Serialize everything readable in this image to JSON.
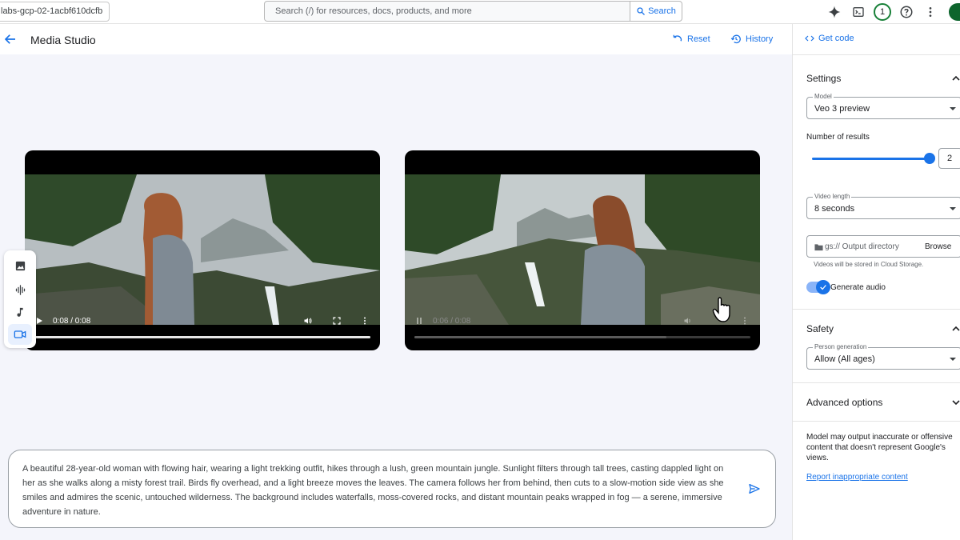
{
  "topbar": {
    "project": "labs-gcp-02-1acbf610dcfb",
    "search_placeholder": "Search (/) for resources, docs, products, and more",
    "search_button": "Search",
    "notification_count": "1"
  },
  "header": {
    "title": "Media Studio",
    "reset": "Reset",
    "history": "History"
  },
  "videos": [
    {
      "time": "0:08 / 0:08",
      "state": "paused",
      "progress": 1.0
    },
    {
      "time": "0:06 / 0:08",
      "state": "playing",
      "progress": 0.75
    }
  ],
  "media_toolbar": [
    "image-icon",
    "audio-wave-icon",
    "music-note-icon",
    "video-icon"
  ],
  "prompt": {
    "text": "A beautiful 28-year-old woman with flowing hair, wearing a light trekking outfit, hikes through a lush, green mountain jungle. Sunlight filters through tall trees, casting dappled light on her as she walks along a misty forest trail. Birds fly overhead, and a light breeze moves the leaves. The camera follows her from behind, then cuts to a slow-motion side view as she smiles and admires the scenic, untouched wilderness. The background includes waterfalls, moss-covered rocks, and distant mountain peaks wrapped in fog — a serene, immersive adventure in nature."
  },
  "panel": {
    "get_code": "Get code",
    "settings": {
      "title": "Settings",
      "model_label": "Model",
      "model_value": "Veo 3 preview",
      "results_label": "Number of results",
      "results_value": "2",
      "length_label": "Video length",
      "length_value": "8 seconds",
      "output_placeholder": "gs:// Output directory",
      "browse": "Browse",
      "storage_note": "Videos will be stored in Cloud Storage.",
      "generate_audio": "Generate audio",
      "generate_audio_on": true
    },
    "safety": {
      "title": "Safety",
      "person_label": "Person generation",
      "person_value": "Allow (All ages)"
    },
    "advanced": {
      "title": "Advanced options"
    },
    "disclaimer": "Model may output inaccurate or offensive content that doesn't represent Google's views.",
    "report": "Report inappropriate content"
  },
  "colors": {
    "accent": "#1a73e8",
    "main_bg": "#f4f5fb",
    "badge_ring": "#188038"
  }
}
